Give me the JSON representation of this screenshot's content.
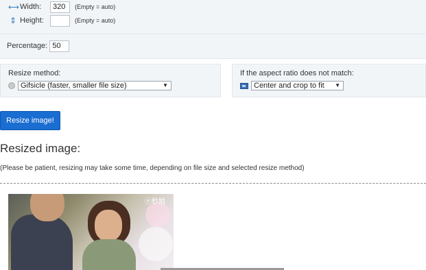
{
  "size": {
    "width_label": "Width:",
    "width_value": "320",
    "width_hint": "(Empty = auto)",
    "height_label": "Height:",
    "height_value": "",
    "height_hint": "(Empty = auto)",
    "percentage_label": "Percentage:",
    "percentage_value": "50"
  },
  "resize_method": {
    "label": "Resize method:",
    "selected": "Gifsicle (faster, smaller file size)"
  },
  "aspect": {
    "label": "If the aspect ratio does not match:",
    "selected": "Center and crop to fit"
  },
  "actions": {
    "resize_button": "Resize image!"
  },
  "result": {
    "heading": "Resized image:",
    "note": "(Please be patient, resizing may take some time, depending on file size and selected resize method)",
    "watermark": "ⓔ秒拍"
  },
  "icons": {
    "width": "horizontal-arrows-icon",
    "height": "vertical-arrows-icon",
    "method": "gear-icon",
    "aspect": "crop-icon"
  },
  "colors": {
    "accent": "#1a6dd1",
    "panel_bg": "#f2f5f8"
  }
}
